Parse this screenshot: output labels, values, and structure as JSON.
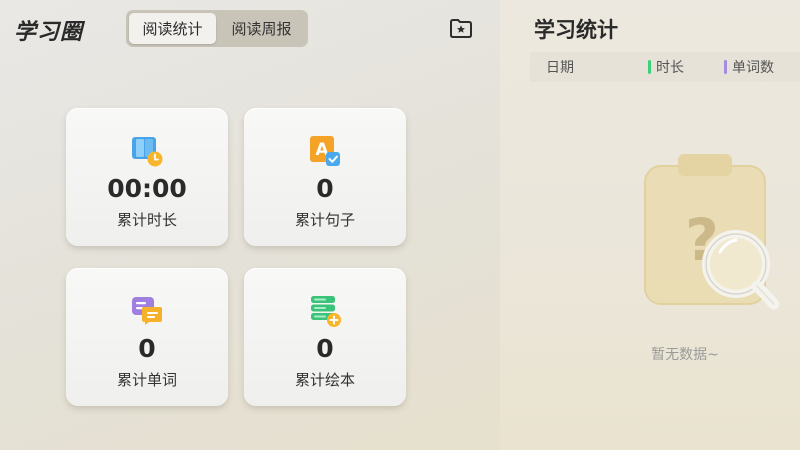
{
  "app": {
    "title": "学习圈"
  },
  "tabs": [
    {
      "label": "阅读统计",
      "active": true
    },
    {
      "label": "阅读周报",
      "active": false
    }
  ],
  "header": {
    "favorite_icon": "star-folder-icon"
  },
  "cards": [
    {
      "value": "00:00",
      "label": "累计时长",
      "icon": "book-clock-icon"
    },
    {
      "value": "0",
      "label": "累计句子",
      "icon": "letter-a-check-icon"
    },
    {
      "value": "0",
      "label": "累计单词",
      "icon": "chat-list-icon"
    },
    {
      "value": "0",
      "label": "累计绘本",
      "icon": "book-stack-plus-icon"
    }
  ],
  "stats_panel": {
    "title": "学习统计",
    "legend": {
      "date": "日期",
      "duration": "时长",
      "words": "单词数"
    },
    "empty_text": "暂无数据~"
  },
  "colors": {
    "duration_bar": "#3fd17a",
    "words_bar": "#a58be0",
    "active_tab_bg": "#f2f1ee",
    "tab_track": "#c9c4b8"
  }
}
